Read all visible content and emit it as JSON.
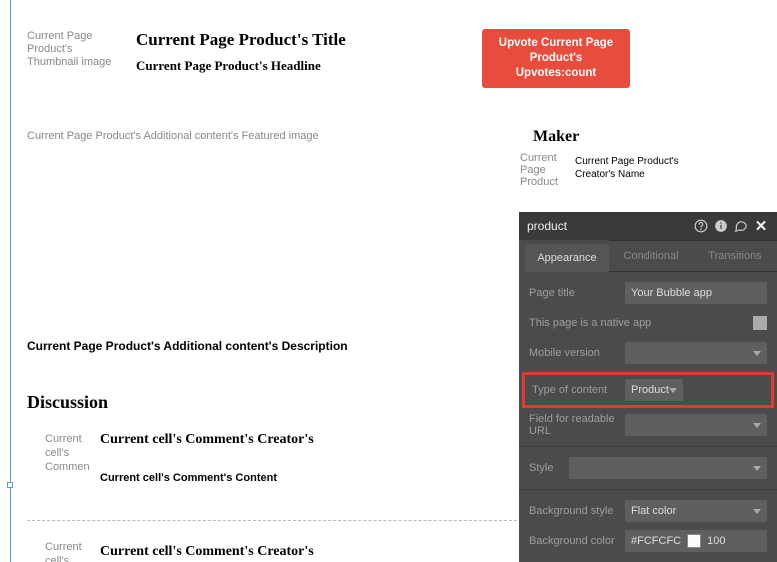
{
  "canvas": {
    "thumbnail_label": "Current Page Product's Thumbnail image",
    "title": "Current Page Product's Title",
    "headline": "Current Page Product's Headline",
    "upvote_label": "Upvote Current Page Product's Upvotes:count",
    "featured_image_label": "Current Page Product's Additional content's Featured image",
    "maker_heading": "Maker",
    "creator_thumb_label": "Current Page Product\n's",
    "creator_name": "Current Page Product's Creator's Name",
    "description_label": "Current Page Product's Additional content's Description",
    "discussion_heading": "Discussion",
    "cell1": {
      "side_label": "Current cell's Commen",
      "creator": "Current cell's Comment's Creator's",
      "content": "Current cell's Comment's Content"
    },
    "cell2": {
      "side_label": "Current cell's",
      "creator": "Current cell's Comment's Creator's"
    }
  },
  "panel": {
    "element_name": "product",
    "tabs": {
      "appearance": "Appearance",
      "conditional": "Conditional",
      "transitions": "Transitions"
    },
    "labels": {
      "page_title": "Page title",
      "native_app": "This page is a native app",
      "mobile_version": "Mobile version",
      "type_of_content": "Type of content",
      "readable_url": "Field for readable URL",
      "style": "Style",
      "background_style": "Background style",
      "background_color": "Background color"
    },
    "values": {
      "page_title": "Your Bubble app",
      "type_of_content": "Product",
      "background_style": "Flat color",
      "bg_color_hex": "#FCFCFC",
      "bg_color_opacity": "100"
    }
  }
}
